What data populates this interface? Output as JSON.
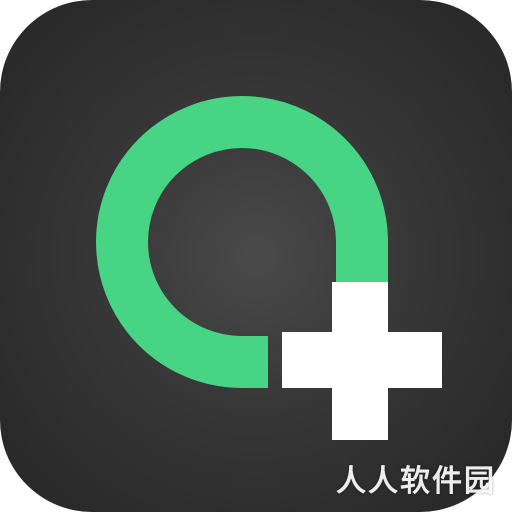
{
  "app_icon": {
    "background_center": "#4a4a4a",
    "background_edge": "#262626",
    "ring_color": "#47d485",
    "plus_color": "#ffffff",
    "ring_icon": "ring-icon",
    "plus_icon": "plus-icon"
  },
  "watermark": {
    "text": "人人软件园"
  }
}
